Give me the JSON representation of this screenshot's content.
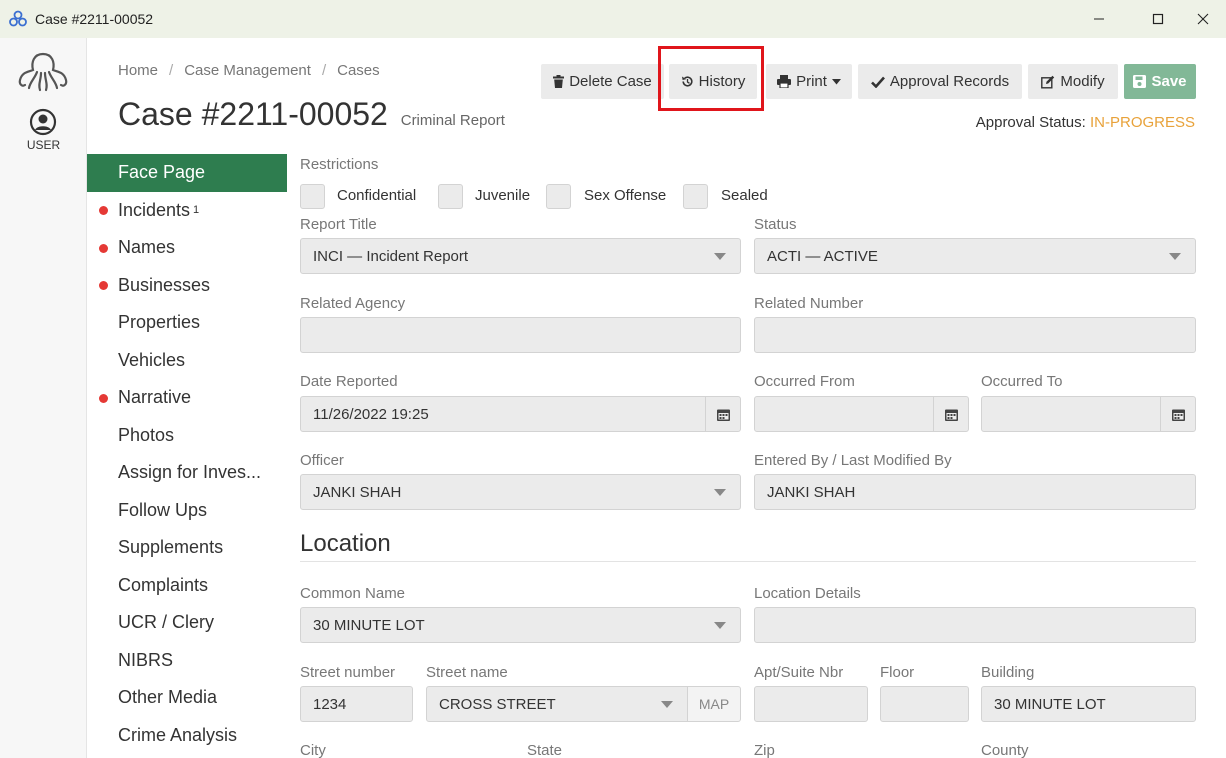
{
  "window": {
    "title": "Case #2211-00052"
  },
  "rail": {
    "user_label": "USER"
  },
  "breadcrumb": [
    "Home",
    "Case Management",
    "Cases"
  ],
  "header": {
    "title": "Case #2211-00052",
    "subtitle": "Criminal Report"
  },
  "toolbar": {
    "delete_label": "Delete Case",
    "history_label": "History",
    "print_label": "Print",
    "approval_records_label": "Approval Records",
    "modify_label": "Modify",
    "save_label": "Save"
  },
  "approval": {
    "label": "Approval Status:",
    "value": "IN-PROGRESS",
    "color": "#e8a23a"
  },
  "sidenav": [
    {
      "label": "Face Page",
      "active": true,
      "dot": false
    },
    {
      "label": "Incidents",
      "badge": "1",
      "dot": true
    },
    {
      "label": "Names",
      "dot": true
    },
    {
      "label": "Businesses",
      "dot": true
    },
    {
      "label": "Properties",
      "dot": false
    },
    {
      "label": "Vehicles",
      "dot": false
    },
    {
      "label": "Narrative",
      "dot": true
    },
    {
      "label": "Photos",
      "dot": false
    },
    {
      "label": "Assign for Inves...",
      "dot": false
    },
    {
      "label": "Follow Ups",
      "dot": false
    },
    {
      "label": "Supplements",
      "dot": false
    },
    {
      "label": "Complaints",
      "dot": false
    },
    {
      "label": "UCR / Clery",
      "dot": false
    },
    {
      "label": "NIBRS",
      "dot": false
    },
    {
      "label": "Other Media",
      "dot": false
    },
    {
      "label": "Crime Analysis",
      "dot": false
    }
  ],
  "form": {
    "restrictions_label": "Restrictions",
    "restrictions": [
      "Confidential",
      "Juvenile",
      "Sex Offense",
      "Sealed"
    ],
    "report_title": {
      "label": "Report Title",
      "value": "INCI — Incident Report"
    },
    "status": {
      "label": "Status",
      "value": "ACTI — ACTIVE"
    },
    "related_agency": {
      "label": "Related Agency",
      "value": ""
    },
    "related_number": {
      "label": "Related Number",
      "value": ""
    },
    "date_reported": {
      "label": "Date Reported",
      "value": "11/26/2022 19:25"
    },
    "occurred_from": {
      "label": "Occurred From",
      "value": ""
    },
    "occurred_to": {
      "label": "Occurred To",
      "value": ""
    },
    "officer": {
      "label": "Officer",
      "value": "JANKI SHAH"
    },
    "entered_by": {
      "label": "Entered By / Last Modified By",
      "value": "JANKI SHAH"
    }
  },
  "location": {
    "title": "Location",
    "common_name": {
      "label": "Common Name",
      "value": "30 MINUTE LOT"
    },
    "location_details": {
      "label": "Location Details",
      "value": ""
    },
    "street_number": {
      "label": "Street number",
      "value": "1234"
    },
    "street_name": {
      "label": "Street name",
      "value": "CROSS STREET"
    },
    "map_label": "MAP",
    "apt": {
      "label": "Apt/Suite Nbr",
      "value": ""
    },
    "floor": {
      "label": "Floor",
      "value": ""
    },
    "building": {
      "label": "Building",
      "value": "30 MINUTE LOT"
    },
    "city_label": "City",
    "state_label": "State",
    "zip_label": "Zip",
    "county_label": "County"
  }
}
